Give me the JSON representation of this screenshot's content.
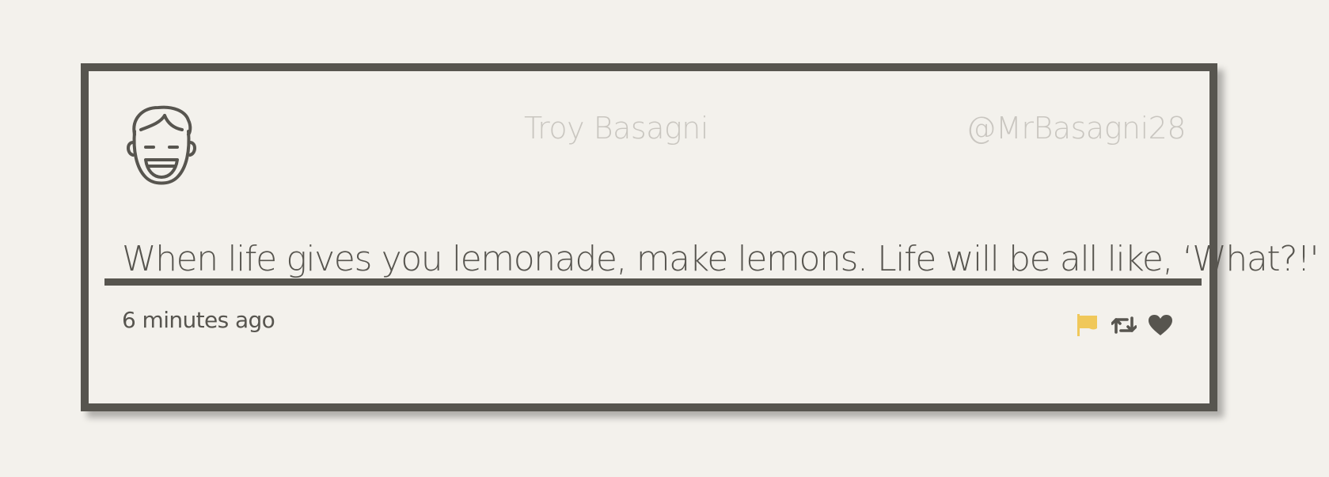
{
  "tweet": {
    "user": {
      "name": "Troy Basagni",
      "handle": "@MrBasagni28",
      "avatar_icon": "smiling-face-avatar-icon"
    },
    "text": "When life gives you lemonade, make lemons. Life will be all like, ‘What?!'",
    "timestamp": "6 minutes ago",
    "actions": [
      {
        "name": "flag-icon",
        "color": "#f0c85a"
      },
      {
        "name": "retweet-icon",
        "color": "#57554f"
      },
      {
        "name": "heart-icon",
        "color": "#57554f"
      }
    ]
  },
  "colors": {
    "background": "#f3f1ec",
    "border": "#57554f",
    "muted_text": "#c9c6c0",
    "body_text": "#57554f",
    "flag_accent": "#f0c85a"
  }
}
